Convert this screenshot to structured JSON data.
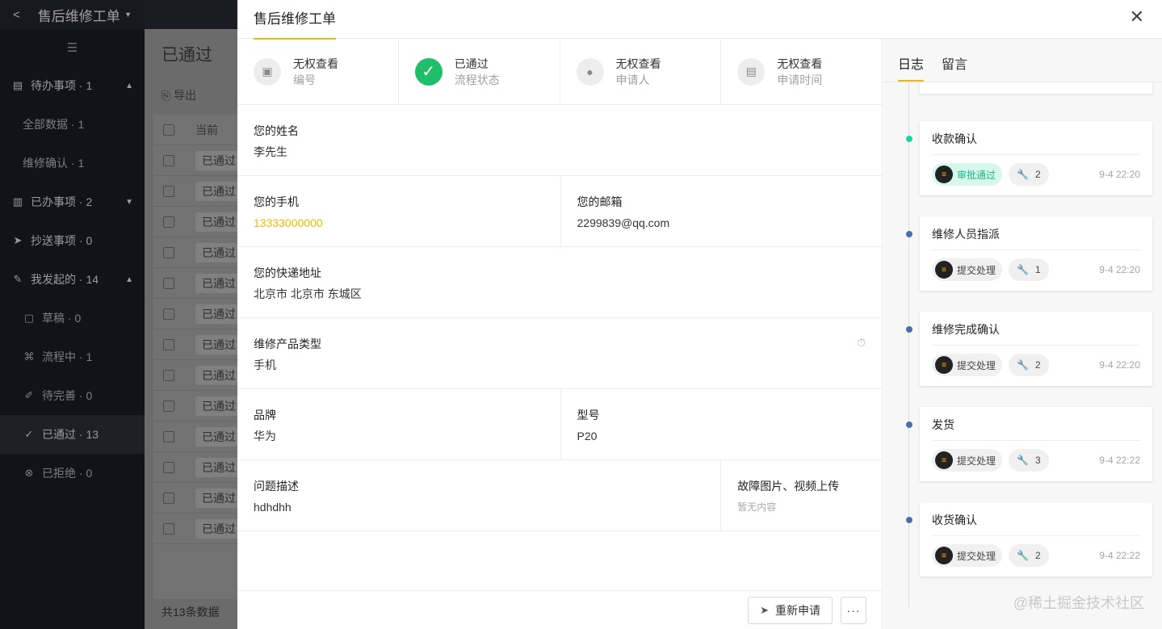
{
  "sidebar": {
    "app_title": "售后维修工单",
    "groups": [
      {
        "label": "待办事项 · 1",
        "icon": "todo-icon",
        "arrow": "▲"
      },
      {
        "label": "已办事项 · 2",
        "icon": "done-icon",
        "arrow": "▼"
      },
      {
        "label": "抄送事项 · 0",
        "icon": "send-icon",
        "arrow": ""
      },
      {
        "label": "我发起的 · 14",
        "icon": "edit-icon",
        "arrow": "▲"
      }
    ],
    "todo_items": [
      "全部数据 · 1",
      "维修确认 · 1"
    ],
    "mine_items": [
      "草稿 · 0",
      "流程中 · 1",
      "待完善 · 0",
      "已通过 · 13",
      "已拒绝 · 0"
    ]
  },
  "background": {
    "page_title": "已通过",
    "export_label": "导出",
    "column_header": "当前",
    "row_tag": "已通过",
    "footer": "共13条数据"
  },
  "drawer": {
    "title": "售后维修工单",
    "summary": [
      {
        "value": "无权查看",
        "label": "编号"
      },
      {
        "value": "已通过",
        "label": "流程状态"
      },
      {
        "value": "无权查看",
        "label": "申请人"
      },
      {
        "value": "无权查看",
        "label": "申请时间"
      }
    ],
    "fields": {
      "name": {
        "label": "您的姓名",
        "value": "李先生"
      },
      "phone": {
        "label": "您的手机",
        "value": "13333000000"
      },
      "email": {
        "label": "您的邮箱",
        "value": "2299839@qq.com"
      },
      "address": {
        "label": "您的快递地址",
        "value": "北京市 北京市 东城区"
      },
      "product_type": {
        "label": "维修产品类型",
        "value": "手机"
      },
      "brand": {
        "label": "品牌",
        "value": "华为"
      },
      "model": {
        "label": "型号",
        "value": "P20"
      },
      "problem": {
        "label": "问题描述",
        "value": "hdhdhh"
      },
      "upload": {
        "label": "故障图片、视频上传",
        "value": "暂无内容"
      }
    },
    "buttons": {
      "reapply": "重新申请",
      "more": "···"
    }
  },
  "log": {
    "tabs": [
      "日志",
      "留言"
    ],
    "entries": [
      {
        "title": "收款确认",
        "status": "审批通过",
        "count": "2",
        "time": "9-4 22:20"
      },
      {
        "title": "维修人员指派",
        "status": "提交处理",
        "count": "1",
        "time": "9-4 22:20"
      },
      {
        "title": "维修完成确认",
        "status": "提交处理",
        "count": "2",
        "time": "9-4 22:20"
      },
      {
        "title": "发货",
        "status": "提交处理",
        "count": "3",
        "time": "9-4 22:22"
      },
      {
        "title": "收货确认",
        "status": "提交处理",
        "count": "2",
        "time": "9-4 22:22"
      }
    ],
    "watermark": "@稀土掘金技术社区"
  }
}
